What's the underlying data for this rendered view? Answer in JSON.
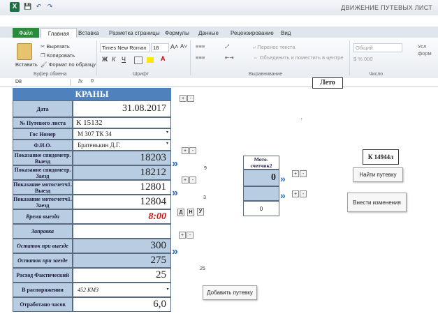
{
  "window": {
    "title": "ДВИЖЕНИЕ ПУТЕВЫХ ЛИСТ"
  },
  "quick_access": {
    "save": "💾",
    "undo": "↶",
    "redo": "↷"
  },
  "tabs": [
    {
      "label": "Файл"
    },
    {
      "label": "Главная"
    },
    {
      "label": "Вставка"
    },
    {
      "label": "Разметка страницы"
    },
    {
      "label": "Формулы"
    },
    {
      "label": "Данные"
    },
    {
      "label": "Рецензирование"
    },
    {
      "label": "Вид"
    }
  ],
  "ribbon": {
    "paste": "Вставить",
    "cut": "Вырезать",
    "copy": "Копировать",
    "format_painter": "Формат по образцу",
    "clipboard_group": "Буфер обмена",
    "font_name": "Times New Roman",
    "font_size": "18",
    "font_group": "Шрифт",
    "bold": "Ж",
    "italic": "К",
    "underline": "Ч",
    "wrap_text": "Перенос текста",
    "merge_center": "Объединить и поместить в центре",
    "alignment_group": "Выравнивание",
    "number_format": "Общий",
    "number_group": "Число",
    "format_partial": "Усл форм"
  },
  "formula_bar": {
    "name_box": "D8",
    "fx": "fx",
    "value": "0"
  },
  "form": {
    "header": "КРАНЫ",
    "season_badge": "Лето",
    "rows": [
      {
        "label": "Дата",
        "value": "31.08.2017"
      },
      {
        "label": "№ Путевого листа",
        "value": "К 15132"
      },
      {
        "label": "Гос Номер",
        "value": "М 307 ТК 34"
      },
      {
        "label": "Ф.И.О.",
        "value": "Братенькин Д.Г."
      },
      {
        "label": "Показание спидометр. Выезд",
        "value": "18203"
      },
      {
        "label": "Показание спидометр. Заезд",
        "value": "18212"
      },
      {
        "label": "Показание мотосчетч1. Выезд",
        "value": "12801"
      },
      {
        "label": "Показание мотосчетч1. Заезд",
        "value": "12804"
      },
      {
        "label": "Время выезда",
        "value": "8:00"
      },
      {
        "label": "Заправка",
        "value": ""
      },
      {
        "label": "Остаток при выезде",
        "value": "300"
      },
      {
        "label": "Остаток при заезде",
        "value": "275"
      },
      {
        "label": "Расход Фактический",
        "value": "25"
      },
      {
        "label": "В распоряжении",
        "value": "452 КМЗ"
      },
      {
        "label": "Отработано часов",
        "value": "6,0"
      }
    ],
    "plus": "+",
    "minus": "-",
    "day_buttons": [
      "Д",
      "Н",
      "У"
    ],
    "speed_diff": "9",
    "moto_diff": "3",
    "fuel_diff": "25",
    "add_trip_button": "Добавить путевку",
    "moto2": {
      "label": "Мото-счетчик2",
      "value": "0",
      "zero": "0"
    },
    "trip_number_badge": "К 14944л",
    "find_trip_button": "Найти путевку",
    "apply_changes_button": "Внести изменения",
    "dot": "·"
  }
}
